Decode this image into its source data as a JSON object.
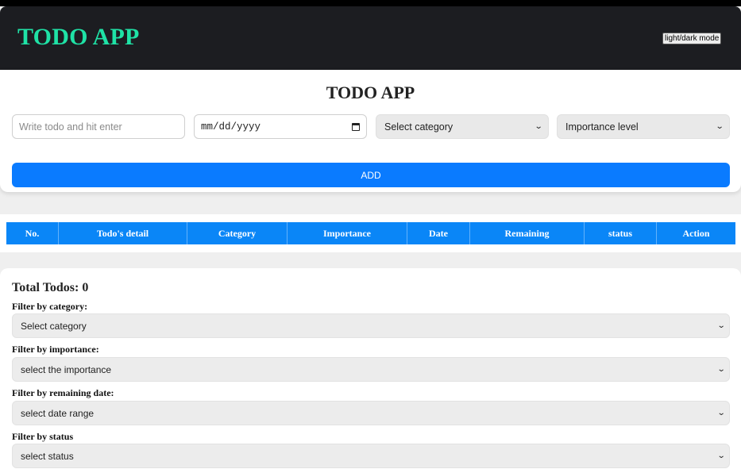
{
  "header": {
    "brand": "TODO APP",
    "theme_toggle": "light/dark mode"
  },
  "form": {
    "title": "TODO APP",
    "todo_placeholder": "Write todo and hit enter",
    "date_value": "mm/dd/yyyy",
    "category_select": "Select category",
    "importance_select": "Importance level",
    "add_label": "ADD"
  },
  "table": {
    "columns": [
      "No.",
      "Todo's detail",
      "Category",
      "Importance",
      "Date",
      "Remaining",
      "status",
      "Action"
    ]
  },
  "filters": {
    "total": "Total Todos: 0",
    "category_label": "Filter by category:",
    "category_value": "Select category",
    "importance_label": "Filter by importance:",
    "importance_value": "select the importance",
    "date_label": "Filter by remaining date:",
    "date_value": "select date range",
    "status_label": "Filter by status",
    "status_value": "select status"
  },
  "colors": {
    "brand": "#1fe2a6",
    "header_bg": "#1c1d21",
    "accent": "#0a7bff",
    "table_header": "#0a86f7"
  }
}
